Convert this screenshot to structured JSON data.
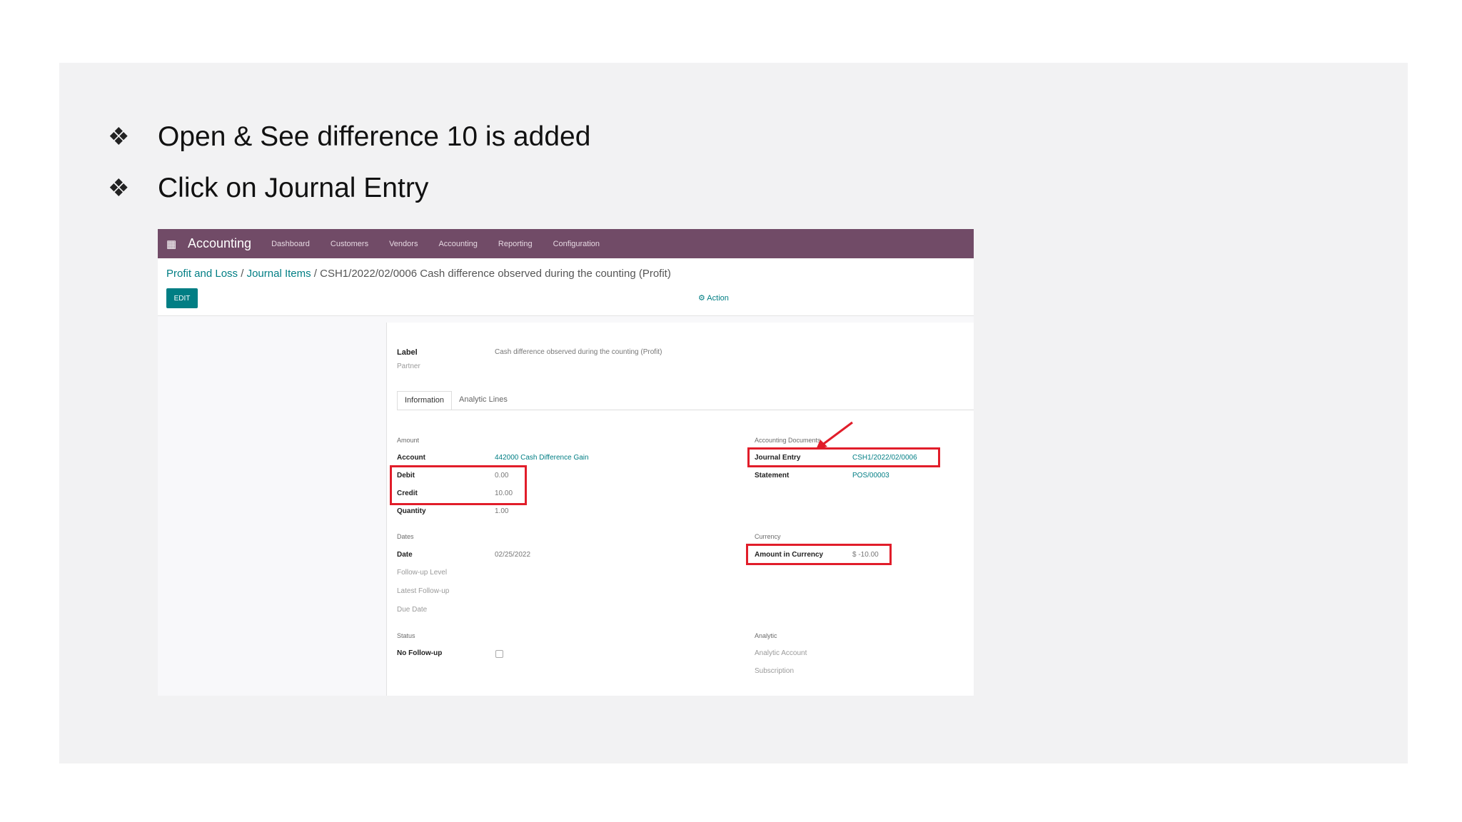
{
  "slide": {
    "bullets": [
      {
        "glyph": "❖",
        "text": "Open & See difference 10 is added"
      },
      {
        "glyph": "❖",
        "text": "Click on Journal Entry"
      }
    ]
  },
  "odoo": {
    "apps_icon": "apps-grid-icon",
    "app_name": "Accounting",
    "menu": [
      "Dashboard",
      "Customers",
      "Vendors",
      "Accounting",
      "Reporting",
      "Configuration"
    ],
    "breadcrumb": {
      "item1": "Profit and Loss",
      "sep": " / ",
      "item2": "Journal Items",
      "current": "CSH1/2022/02/0006 Cash difference observed during the counting (Profit)"
    },
    "edit_label": "EDIT",
    "action_label": "⚙ Action",
    "form": {
      "label_label": "Label",
      "label_value": "Cash difference observed during the counting (Profit)",
      "partner_label": "Partner",
      "tabs": [
        "Information",
        "Analytic Lines"
      ],
      "amount_group": "Amount",
      "account_label": "Account",
      "account_value": "442000 Cash Difference Gain",
      "debit_label": "Debit",
      "debit_value": "0.00",
      "credit_label": "Credit",
      "credit_value": "10.00",
      "quantity_label": "Quantity",
      "quantity_value": "1.00",
      "dates_group": "Dates",
      "date_label": "Date",
      "date_value": "02/25/2022",
      "followup_level_label": "Follow-up Level",
      "latest_followup_label": "Latest Follow-up",
      "due_date_label": "Due Date",
      "status_group": "Status",
      "no_followup_label": "No Follow-up",
      "acc_docs_group": "Accounting Documents",
      "journal_entry_label": "Journal Entry",
      "journal_entry_value": "CSH1/2022/02/0006",
      "statement_label": "Statement",
      "statement_value": "POS/00003",
      "currency_group": "Currency",
      "amount_currency_label": "Amount in Currency",
      "amount_currency_value": "$ -10.00",
      "analytic_group": "Analytic",
      "analytic_account_label": "Analytic Account",
      "subscription_label": "Subscription"
    }
  },
  "annotation_color": "#e11d2a"
}
